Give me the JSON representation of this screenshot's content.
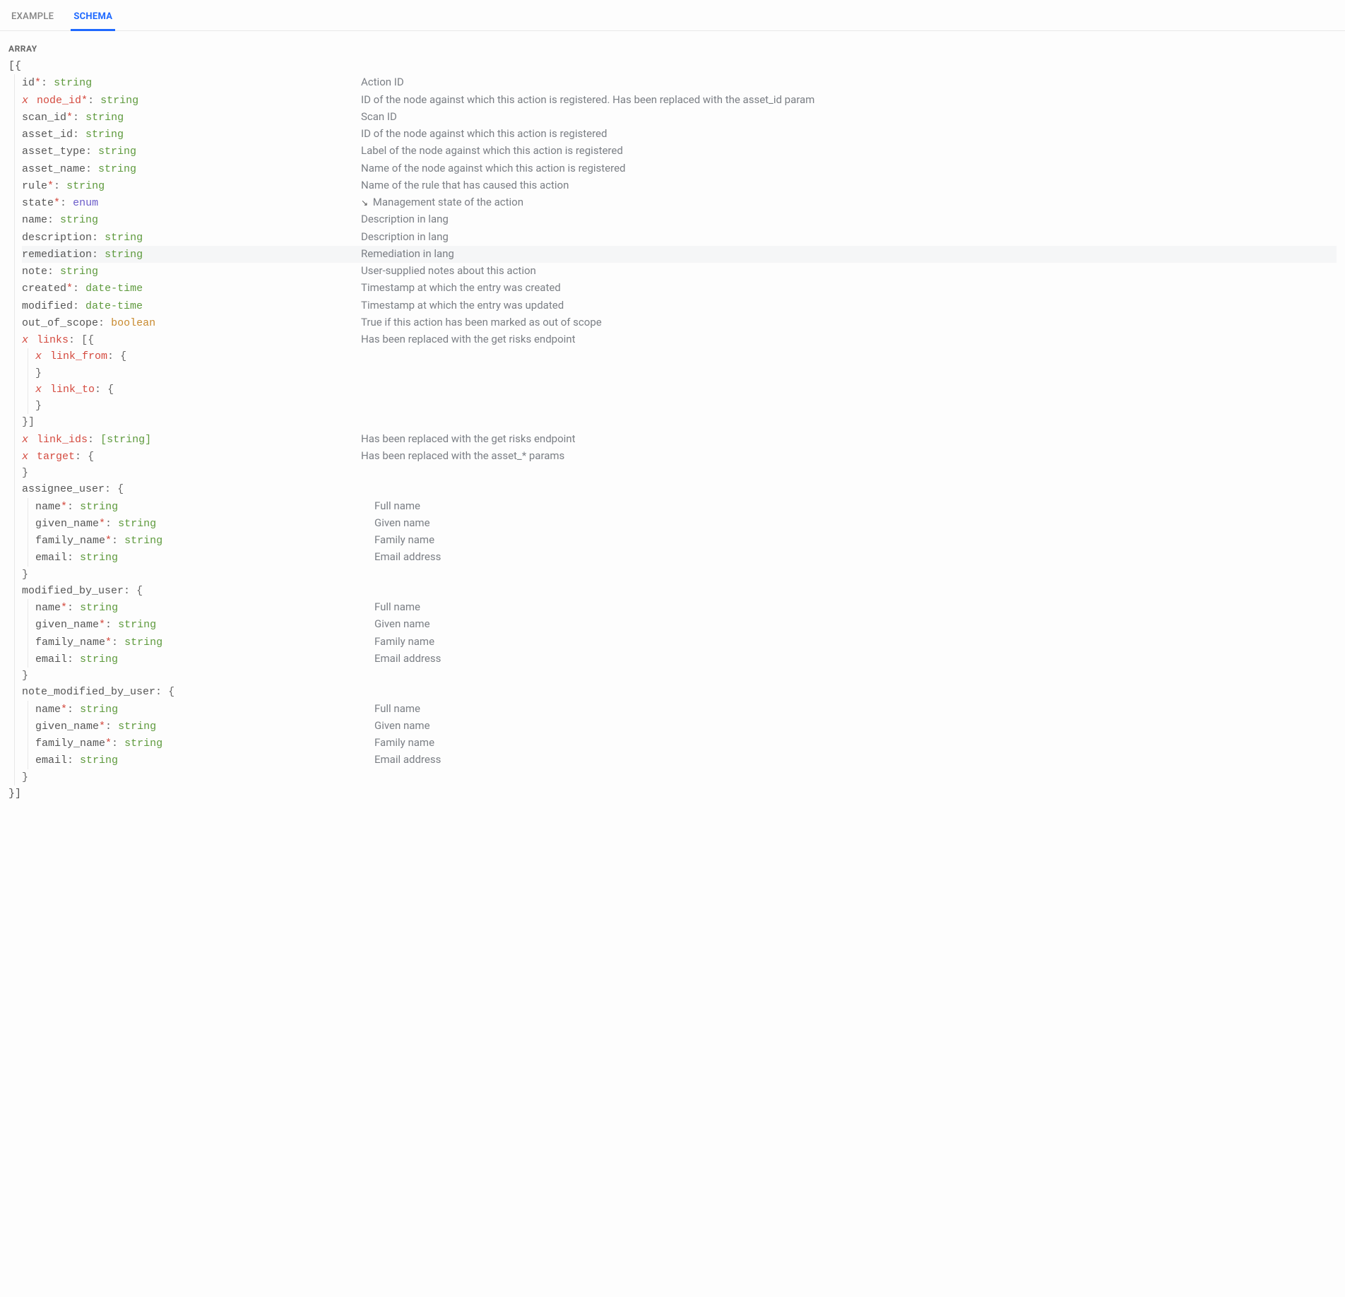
{
  "tabs": {
    "example": "EXAMPLE",
    "schema": "SCHEMA"
  },
  "array_label": "ARRAY",
  "open": "[{",
  "close": "}]",
  "top_fields": [
    {
      "name": "id",
      "required": true,
      "deprecated": false,
      "type": "string",
      "tclass": "k-type-string",
      "desc": "Action ID"
    },
    {
      "name": "node_id",
      "required": true,
      "deprecated": true,
      "type": "string",
      "tclass": "k-type-string",
      "desc": "ID of the node against which this action is registered. Has been replaced with the asset_id param"
    },
    {
      "name": "scan_id",
      "required": true,
      "deprecated": false,
      "type": "string",
      "tclass": "k-type-string",
      "desc": "Scan ID"
    },
    {
      "name": "asset_id",
      "required": false,
      "deprecated": false,
      "type": "string",
      "tclass": "k-type-string",
      "desc": "ID of the node against which this action is registered"
    },
    {
      "name": "asset_type",
      "required": false,
      "deprecated": false,
      "type": "string",
      "tclass": "k-type-string",
      "desc": "Label of the node against which this action is registered"
    },
    {
      "name": "asset_name",
      "required": false,
      "deprecated": false,
      "type": "string",
      "tclass": "k-type-string",
      "desc": "Name of the node against which this action is registered"
    },
    {
      "name": "rule",
      "required": true,
      "deprecated": false,
      "type": "string",
      "tclass": "k-type-string",
      "desc": "Name of the rule that has caused this action"
    },
    {
      "name": "state",
      "required": true,
      "deprecated": false,
      "type": "enum",
      "tclass": "k-type-enum",
      "desc": "Management state of the action",
      "arrow": true
    },
    {
      "name": "name",
      "required": false,
      "deprecated": false,
      "type": "string",
      "tclass": "k-type-string",
      "desc": "Description in lang"
    },
    {
      "name": "description",
      "required": false,
      "deprecated": false,
      "type": "string",
      "tclass": "k-type-string",
      "desc": "Description in lang"
    },
    {
      "name": "remediation",
      "required": false,
      "deprecated": false,
      "type": "string",
      "tclass": "k-type-string",
      "desc": "Remediation in lang",
      "highlight": true
    },
    {
      "name": "note",
      "required": false,
      "deprecated": false,
      "type": "string",
      "tclass": "k-type-string",
      "desc": "User-supplied notes about this action"
    },
    {
      "name": "created",
      "required": true,
      "deprecated": false,
      "type": "date-time",
      "tclass": "k-type-datetime",
      "desc": "Timestamp at which the entry was created"
    },
    {
      "name": "modified",
      "required": false,
      "deprecated": false,
      "type": "date-time",
      "tclass": "k-type-datetime",
      "desc": "Timestamp at which the entry was updated"
    },
    {
      "name": "out_of_scope",
      "required": false,
      "deprecated": false,
      "type": "boolean",
      "tclass": "k-type-bool",
      "desc": "True if this action has been marked as out of scope"
    }
  ],
  "links": {
    "name": "links",
    "open": "[{",
    "close": "}]",
    "desc": "Has been replaced with the get risks endpoint",
    "children": [
      {
        "name": "link_from",
        "open": "{",
        "close": "}"
      },
      {
        "name": "link_to",
        "open": "{",
        "close": "}"
      }
    ]
  },
  "link_ids": {
    "name": "link_ids",
    "type": "[string]",
    "desc": "Has been replaced with the get risks endpoint"
  },
  "target": {
    "name": "target",
    "open": "{",
    "close": "}",
    "desc": "Has been replaced with the asset_* params"
  },
  "user_objects": [
    {
      "name": "assignee_user"
    },
    {
      "name": "modified_by_user"
    },
    {
      "name": "note_modified_by_user"
    }
  ],
  "user_fields": [
    {
      "name": "name",
      "required": true,
      "type": "string",
      "desc": "Full name"
    },
    {
      "name": "given_name",
      "required": true,
      "type": "string",
      "desc": "Given name"
    },
    {
      "name": "family_name",
      "required": true,
      "type": "string",
      "desc": "Family name"
    },
    {
      "name": "email",
      "required": false,
      "type": "string",
      "desc": "Email address"
    }
  ]
}
